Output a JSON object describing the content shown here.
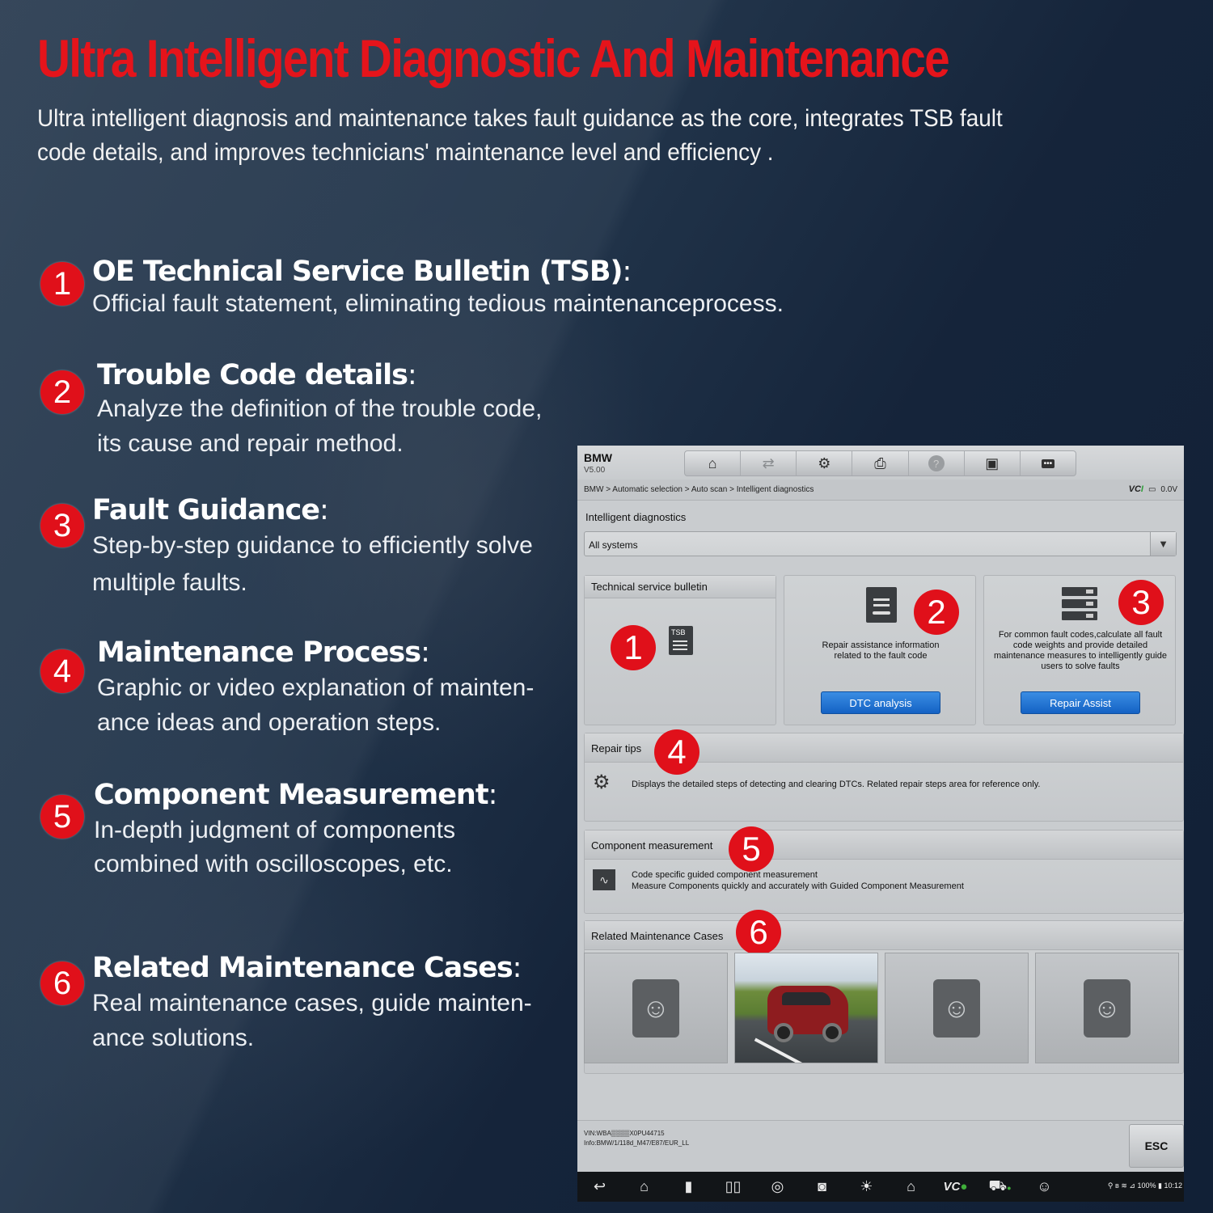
{
  "header": {
    "title": "Ultra Intelligent Diagnostic And Maintenance",
    "subtitle_line1": "Ultra intelligent diagnosis and maintenance takes fault guidance as the core, integrates TSB fault",
    "subtitle_line2": "code details, and improves technicians' maintenance level and efficiency ."
  },
  "colors": {
    "accent_red": "#e0101a",
    "title_red": "#e5141b",
    "button_blue": "#1a6fd0",
    "background_navy": "#15243a"
  },
  "features": [
    {
      "num": "1",
      "title": "OE Technical Service Bulletin (TSB)",
      "lines": [
        "Official fault  statement, eliminating tedious maintenanceprocess."
      ]
    },
    {
      "num": "2",
      "title": "Trouble Code details",
      "lines": [
        "Analyze the definition of the trouble code,",
        "its cause and repair method."
      ]
    },
    {
      "num": "3",
      "title": "Fault Guidance",
      "lines": [
        "Step-by-step guidance to efficiently solve",
        "multiple faults."
      ]
    },
    {
      "num": "4",
      "title": "Maintenance Process",
      "lines": [
        "Graphic or video explanation of mainten-",
        "ance ideas and operation steps."
      ]
    },
    {
      "num": "5",
      "title": "Component Measurement",
      "lines": [
        "In-depth judgment of components",
        "combined with oscilloscopes, etc."
      ]
    },
    {
      "num": "6",
      "title": "Related Maintenance Cases",
      "lines": [
        "Real maintenance cases, guide mainten-",
        "ance solutions."
      ]
    }
  ],
  "tablet": {
    "brand": "BMW",
    "version": "V5.00",
    "toolbar": [
      {
        "icon": "home-m-icon",
        "glyph": "⌂"
      },
      {
        "icon": "vehicle-swap-icon",
        "glyph": "⇄"
      },
      {
        "icon": "settings-gear-icon",
        "glyph": "⚙"
      },
      {
        "icon": "printer-icon",
        "glyph": "⎙"
      },
      {
        "icon": "help-icon",
        "glyph": "?"
      },
      {
        "icon": "save-icon",
        "glyph": "▣"
      },
      {
        "icon": "chat-icon",
        "glyph": "…"
      }
    ],
    "breadcrumb": "BMW > Automatic selection > Auto scan > Intelligent diagnostics",
    "vci_label": "VCI",
    "voltage": "0.0V",
    "section_title": "Intelligent diagnostics",
    "dropdown_value": "All systems",
    "cards": [
      {
        "title": "Technical service bulletin",
        "icon_label": "TSB",
        "badge": "1"
      },
      {
        "text": "Repair assistance information related to the fault code",
        "button": "DTC analysis",
        "badge": "2"
      },
      {
        "text": "For common fault codes,calculate all fault code weights and provide detailed maintenance measures to intelligently guide users to solve faults",
        "button": "Repair Assist",
        "badge": "3"
      }
    ],
    "repair_tips": {
      "title": "Repair tips",
      "badge": "4",
      "text": "Displays the detailed steps of detecting and clearing DTCs. Related repair steps area for reference only."
    },
    "component": {
      "title": "Component measurement",
      "badge": "5",
      "line1": "Code specific guided component measurement",
      "line2": "Measure Components quickly and accurately with Guided Component Measurement"
    },
    "cases": {
      "title": "Related Maintenance Cases",
      "badge": "6",
      "count": 4
    },
    "vin": "VIN:WBA▒▒▒▒X0PU44715",
    "info": "Info:BMW/1/118d_M47/E87/EUR_LL",
    "esc_label": "ESC",
    "navbar": [
      {
        "icon": "back-icon",
        "glyph": "↩"
      },
      {
        "icon": "home-icon",
        "glyph": "⌂"
      },
      {
        "icon": "recent-apps-icon",
        "glyph": "▮"
      },
      {
        "icon": "split-screen-icon",
        "glyph": "▯▯"
      },
      {
        "icon": "browser-icon",
        "glyph": "◎"
      },
      {
        "icon": "camera-icon",
        "glyph": "◙"
      },
      {
        "icon": "brightness-icon",
        "glyph": "☀"
      },
      {
        "icon": "maxifix-home-icon",
        "glyph": "⌂"
      },
      {
        "icon": "vci-icon",
        "glyph": "VCI"
      },
      {
        "icon": "vehicle-icon",
        "glyph": "🚗"
      },
      {
        "icon": "remote-expert-icon",
        "glyph": "☺"
      }
    ],
    "status": {
      "battery": "100%",
      "time": "10:12"
    }
  }
}
